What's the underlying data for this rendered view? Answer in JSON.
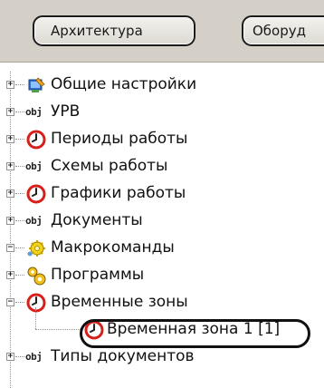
{
  "toolbar": {
    "buttons": [
      {
        "label": "Архитектура"
      },
      {
        "label": "Оборуд"
      }
    ]
  },
  "tree": {
    "items": [
      {
        "label": "Общие настройки",
        "icon": "settings-icon",
        "expander": "+"
      },
      {
        "label": "УРВ",
        "icon": "obj-icon",
        "expander": "+",
        "icon_text": "obj"
      },
      {
        "label": "Периоды работы",
        "icon": "clock-icon",
        "expander": "+"
      },
      {
        "label": "Схемы работы",
        "icon": "obj-icon",
        "expander": "+",
        "icon_text": "obj"
      },
      {
        "label": "Графики работы",
        "icon": "clock-icon",
        "expander": "+"
      },
      {
        "label": "Документы",
        "icon": "obj-icon",
        "expander": "+",
        "icon_text": "obj"
      },
      {
        "label": "Макрокоманды",
        "icon": "macro-gear-icon",
        "expander": "−"
      },
      {
        "label": "Программы",
        "icon": "programs-icon",
        "expander": "+"
      },
      {
        "label": "Временные зоны",
        "icon": "clock-icon",
        "expander": "−"
      },
      {
        "label": "Временная зона 1 [1]",
        "icon": "clock-icon",
        "selected": true
      },
      {
        "label": "Типы документов",
        "icon": "obj-icon",
        "expander": "+",
        "icon_text": "obj"
      }
    ]
  },
  "colors": {
    "toolbar_bg": "#d4d0c8",
    "clock_red": "#d4211b",
    "tree_line": "#909090"
  }
}
